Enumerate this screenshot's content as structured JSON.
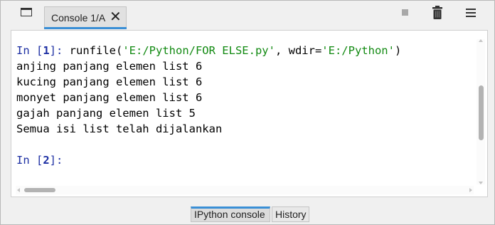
{
  "toolbar": {
    "tab_label": "Console 1/A",
    "tab_close_glyph": "✕",
    "icons": [
      "window-icon",
      "stop-icon",
      "trash-icon",
      "menu-icon"
    ]
  },
  "console": {
    "line1": {
      "prompt_label": "In [",
      "prompt_num": "1",
      "prompt_end": "]: ",
      "code_a": "runfile(",
      "str_a": "'E:/Python/FOR ELSE.py'",
      "code_b": ", wdir=",
      "str_b": "'E:/Python'",
      "code_c": ")"
    },
    "output": [
      "anjing panjang elemen list 6",
      "kucing panjang elemen list 6",
      "monyet panjang elemen list 6",
      "gajah panjang elemen list 5",
      "Semua isi list telah dijalankan"
    ],
    "line2": {
      "prompt_label": "In [",
      "prompt_num": "2",
      "prompt_end": "]:"
    }
  },
  "bottom_tabs": [
    {
      "label": "IPython console",
      "active": true
    },
    {
      "label": "History",
      "active": false
    }
  ],
  "colors": {
    "prompt": "#1d2fa3",
    "string": "#128a12",
    "accent": "#3a8fd6"
  }
}
